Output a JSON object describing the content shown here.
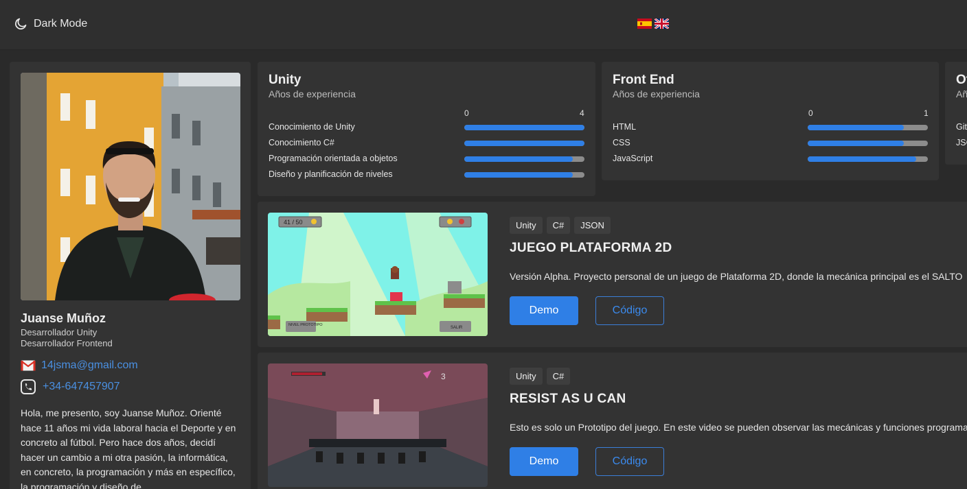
{
  "header": {
    "dark_mode_label": "Dark Mode",
    "languages": [
      "es",
      "en"
    ]
  },
  "profile": {
    "name": "Juanse Muñoz",
    "roles": [
      "Desarrollador Unity",
      "Desarrollador Frontend"
    ],
    "email": "14jsma@gmail.com",
    "phone": "+34-647457907",
    "bio": "Hola, me presento, soy Juanse Muñoz. Orienté hace 11 años mi vida laboral hacia el Deporte y en concreto al fútbol. Pero hace dos años, decidí hacer un cambio a mi otra pasión, la informática, en concreto, la programación y más en específico, la programación y diseño de"
  },
  "skills": [
    {
      "title": "Unity",
      "subtitle": "Años de experiencia",
      "scale_min": "0",
      "scale_max": "4",
      "items": [
        {
          "label": "Conocimiento de Unity",
          "level": 1.0
        },
        {
          "label": "Conocimiento C#",
          "level": 1.0
        },
        {
          "label": "Programación orientada a objetos",
          "level": 0.9
        },
        {
          "label": "Diseño y planificación de niveles",
          "level": 0.9
        }
      ]
    },
    {
      "title": "Front End",
      "subtitle": "Años de experiencia",
      "scale_min": "0",
      "scale_max": "1",
      "items": [
        {
          "label": "HTML",
          "level": 0.8
        },
        {
          "label": "CSS",
          "level": 0.8
        },
        {
          "label": "JavaScript",
          "level": 0.9
        }
      ]
    },
    {
      "title": "Ot",
      "subtitle": "Añ",
      "items": [
        {
          "label": "Git"
        },
        {
          "label": "JSO"
        }
      ]
    }
  ],
  "projects": [
    {
      "tags": [
        "Unity",
        "C#",
        "JSON"
      ],
      "title": "JUEGO PLATAFORMA 2D",
      "description": "Versión Alpha. Proyecto personal de un juego de Plataforma 2D, donde la mecánica principal es el SALTO",
      "demo_label": "Demo",
      "code_label": "Código",
      "hud_counter": "41 / 50",
      "hud_sign1": "NIVEL PROTOTIPO",
      "hud_sign2": "SALIR"
    },
    {
      "tags": [
        "Unity",
        "C#"
      ],
      "title": "RESIST AS U CAN",
      "description": "Esto es solo un Prototipo del juego. En este video se pueden observar las mecánicas y funciones programadas",
      "demo_label": "Demo",
      "code_label": "Código",
      "hud_counter": "3"
    }
  ]
}
